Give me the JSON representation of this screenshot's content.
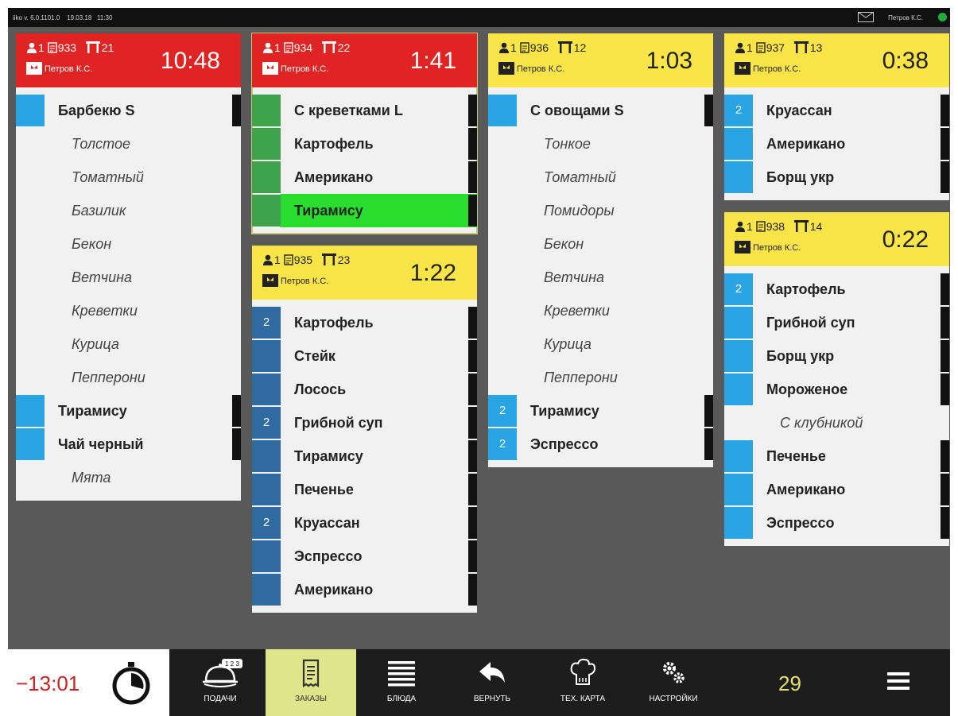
{
  "topbar": {
    "version": "iiko v. 6.0.1101.0",
    "date": "19.03.18",
    "time": "11:30",
    "user": "Петров К.С."
  },
  "colors": {
    "red_header": "#e02424",
    "yellow_header": "#f9e548",
    "qty_blue": "#29a5e3",
    "qty_dark": "#2f6aa0",
    "qty_green": "#3ea34a",
    "highlight_green": "#29dd2e",
    "active_nav": "#dfe58a"
  },
  "orders": [
    {
      "guests": "1",
      "number": "933",
      "table": "21",
      "waiter": "Петров К.С.",
      "time": "10:48",
      "status": "red",
      "items": [
        {
          "qty": "",
          "name": "Барбекю S"
        },
        {
          "name": "Толстое",
          "mod": true
        },
        {
          "name": "Томатный",
          "mod": true
        },
        {
          "name": "Базилик",
          "mod": true
        },
        {
          "name": "Бекон",
          "mod": true
        },
        {
          "name": "Ветчина",
          "mod": true
        },
        {
          "name": "Креветки",
          "mod": true
        },
        {
          "name": "Курица",
          "mod": true
        },
        {
          "name": "Пепперони",
          "mod": true
        },
        {
          "qty": "",
          "name": "Тирамису"
        },
        {
          "qty": "",
          "name": "Чай черный"
        },
        {
          "name": "Мята",
          "mod": true
        }
      ]
    },
    {
      "guests": "1",
      "number": "934",
      "table": "22",
      "waiter": "Петров К.С.",
      "time": "1:41",
      "status": "red",
      "selected": true,
      "items": [
        {
          "qty": "",
          "name": "С креветками L",
          "color": "green"
        },
        {
          "qty": "",
          "name": "Картофель",
          "color": "green"
        },
        {
          "qty": "",
          "name": "Американо",
          "color": "green"
        },
        {
          "qty": "",
          "name": "Тирамису",
          "color": "green",
          "highlight": true
        }
      ]
    },
    {
      "guests": "1",
      "number": "935",
      "table": "23",
      "waiter": "Петров К.С.",
      "time": "1:22",
      "status": "yellow",
      "items": [
        {
          "qty": "2",
          "name": "Картофель",
          "color": "dark"
        },
        {
          "qty": "",
          "name": "Стейк",
          "color": "dark"
        },
        {
          "qty": "",
          "name": "Лосось",
          "color": "dark"
        },
        {
          "qty": "2",
          "name": "Грибной суп",
          "color": "dark"
        },
        {
          "qty": "",
          "name": "Тирамису",
          "color": "dark"
        },
        {
          "qty": "",
          "name": "Печенье",
          "color": "dark"
        },
        {
          "qty": "2",
          "name": "Круассан",
          "color": "dark"
        },
        {
          "qty": "",
          "name": "Эспрессо",
          "color": "dark"
        },
        {
          "qty": "",
          "name": "Американо",
          "color": "dark"
        }
      ]
    },
    {
      "guests": "1",
      "number": "936",
      "table": "12",
      "waiter": "Петров К.С.",
      "time": "1:03",
      "status": "yellow",
      "items": [
        {
          "qty": "",
          "name": "С овощами S"
        },
        {
          "name": "Тонкое",
          "mod": true
        },
        {
          "name": "Томатный",
          "mod": true
        },
        {
          "name": "Помидоры",
          "mod": true
        },
        {
          "name": "Бекон",
          "mod": true
        },
        {
          "name": "Ветчина",
          "mod": true
        },
        {
          "name": "Креветки",
          "mod": true
        },
        {
          "name": "Курица",
          "mod": true
        },
        {
          "name": "Пепперони",
          "mod": true
        },
        {
          "qty": "2",
          "name": "Тирамису"
        },
        {
          "qty": "2",
          "name": "Эспрессо"
        }
      ]
    },
    {
      "guests": "1",
      "number": "937",
      "table": "13",
      "waiter": "Петров К.С.",
      "time": "0:38",
      "status": "yellow",
      "items": [
        {
          "qty": "2",
          "name": "Круассан"
        },
        {
          "qty": "",
          "name": "Американо"
        },
        {
          "qty": "",
          "name": "Борщ укр"
        }
      ]
    },
    {
      "guests": "1",
      "number": "938",
      "table": "14",
      "waiter": "Петров К.С.",
      "time": "0:22",
      "status": "yellow",
      "items": [
        {
          "qty": "2",
          "name": "Картофель"
        },
        {
          "qty": "",
          "name": "Грибной суп"
        },
        {
          "qty": "",
          "name": "Борщ укр"
        },
        {
          "qty": "",
          "name": "Мороженое"
        },
        {
          "name": "С клубникой",
          "mod": true
        },
        {
          "qty": "",
          "name": "Печенье"
        },
        {
          "qty": "",
          "name": "Американо"
        },
        {
          "qty": "",
          "name": "Эспрессо"
        }
      ]
    }
  ],
  "bottom": {
    "timer": "−13:01",
    "timer_icon": "stopwatch-icon",
    "nav": [
      {
        "label": "ПОДАЧИ",
        "icon": "cloche-icon",
        "badge": "1 2 3"
      },
      {
        "label": "ЗАКАЗЫ",
        "icon": "receipt-icon",
        "active": true
      },
      {
        "label": "БЛЮДА",
        "icon": "list-icon"
      },
      {
        "label": "ВЕРНУТЬ",
        "icon": "undo-arrow-icon"
      },
      {
        "label": "ТЕХ. КАРТА",
        "icon": "chef-hat-icon"
      },
      {
        "label": "НАСТРОЙКИ",
        "icon": "gears-icon"
      }
    ],
    "count": "29",
    "menu_icon": "hamburger-menu-icon"
  }
}
